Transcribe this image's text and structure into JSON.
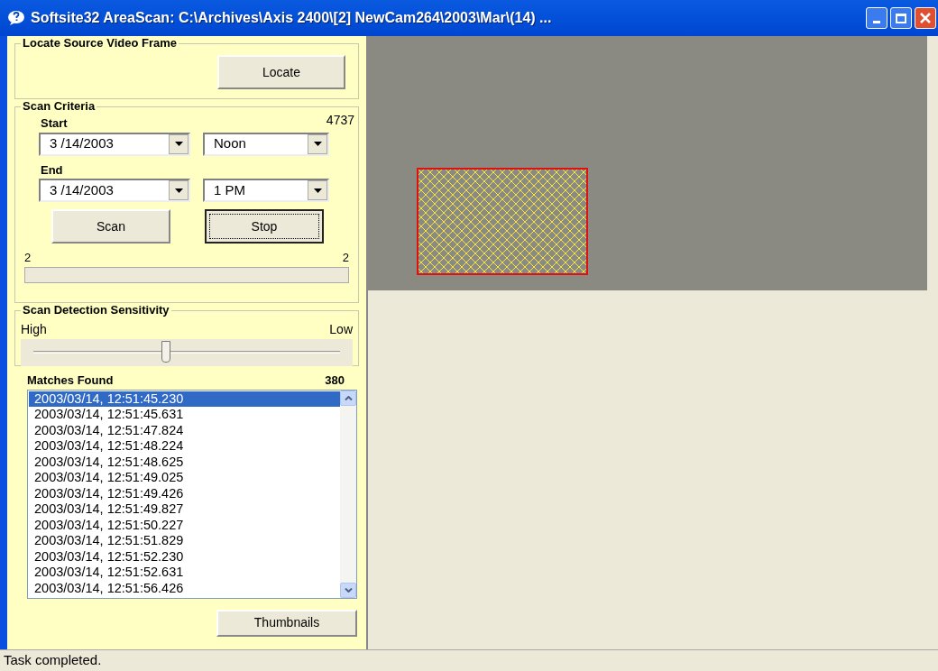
{
  "window": {
    "title": "Softsite32 AreaScan: C:\\Archives\\Axis 2400\\[2] NewCam264\\2003\\Mar\\(14) ..."
  },
  "locate_group": {
    "title": "Locate Source Video Frame",
    "button": {
      "label": "Locate",
      "focused": false
    }
  },
  "scan_criteria": {
    "title": "Scan Criteria",
    "count": "4737",
    "start": {
      "label": "Start",
      "date": "3 /14/2003",
      "time": "Noon"
    },
    "end": {
      "label": "End",
      "date": "3 /14/2003",
      "time": "1 PM"
    },
    "buttons": [
      {
        "label": "Scan",
        "focused": false
      },
      {
        "label": "Stop",
        "focused": true
      }
    ],
    "progress": {
      "min_label": "2",
      "max_label": "2",
      "level": 0
    }
  },
  "sensitivity": {
    "title": "Scan Detection Sensitivity",
    "high_label": "High",
    "low_label": "Low",
    "level": 0.43
  },
  "matches": {
    "title": "Matches Found",
    "count": "380",
    "items": [
      {
        "text": "2003/03/14, 12:51:45.230",
        "selected": true
      },
      {
        "text": "2003/03/14, 12:51:45.631",
        "selected": false
      },
      {
        "text": "2003/03/14, 12:51:47.824",
        "selected": false
      },
      {
        "text": "2003/03/14, 12:51:48.224",
        "selected": false
      },
      {
        "text": "2003/03/14, 12:51:48.625",
        "selected": false
      },
      {
        "text": "2003/03/14, 12:51:49.025",
        "selected": false
      },
      {
        "text": "2003/03/14, 12:51:49.426",
        "selected": false
      },
      {
        "text": "2003/03/14, 12:51:49.827",
        "selected": false
      },
      {
        "text": "2003/03/14, 12:51:50.227",
        "selected": false
      },
      {
        "text": "2003/03/14, 12:51:51.829",
        "selected": false
      },
      {
        "text": "2003/03/14, 12:51:52.230",
        "selected": false
      },
      {
        "text": "2003/03/14, 12:51:52.631",
        "selected": false
      },
      {
        "text": "2003/03/14, 12:51:56.426",
        "selected": false
      }
    ],
    "button": {
      "label": "Thumbnails",
      "focused": false
    }
  },
  "status_bar": {
    "text": "Task completed."
  }
}
